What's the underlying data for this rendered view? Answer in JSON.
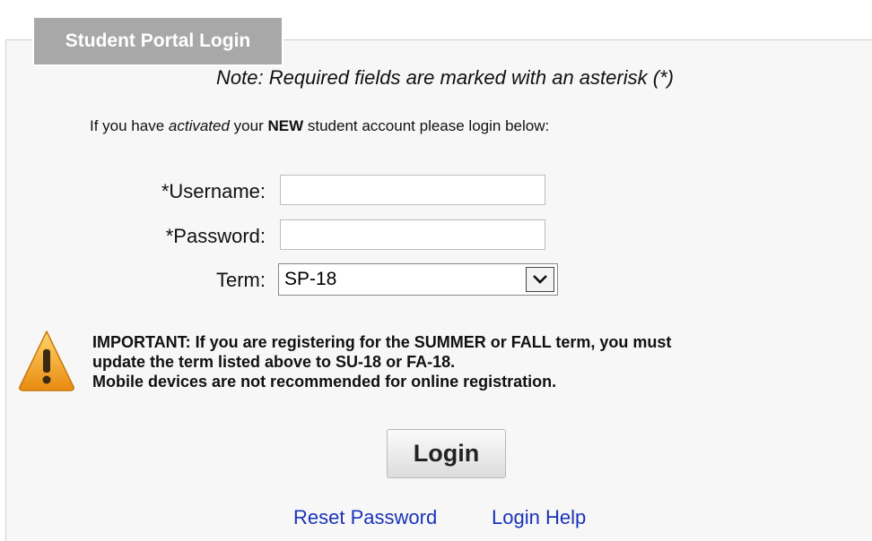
{
  "legend": {
    "title": "Student Portal Login"
  },
  "note": "Note: Required fields are marked with an asterisk (*)",
  "intro": {
    "prefix": "If you have ",
    "activated": "activated",
    "middle": " your ",
    "new": "NEW",
    "suffix": " student account please login below:"
  },
  "form": {
    "username_label": "*Username:",
    "username_value": "",
    "password_label": "*Password:",
    "password_value": "",
    "term_label": "Term:",
    "term_selected": "SP-18"
  },
  "important": {
    "line1": "IMPORTANT: If you are registering for the SUMMER or FALL term, you must",
    "line2": "update the term listed above to SU-18 or FA-18.",
    "line3": "Mobile devices are not recommended for online registration."
  },
  "login_button": "Login",
  "links": {
    "reset_password": "Reset Password",
    "login_help": "Login Help"
  },
  "colors": {
    "legend_bg": "#a8a8a8",
    "link": "#1a33b8",
    "warning_orange": "#f0a21c"
  },
  "icons": {
    "warning": "warning-icon",
    "select_arrow": "chevron-down-icon"
  }
}
